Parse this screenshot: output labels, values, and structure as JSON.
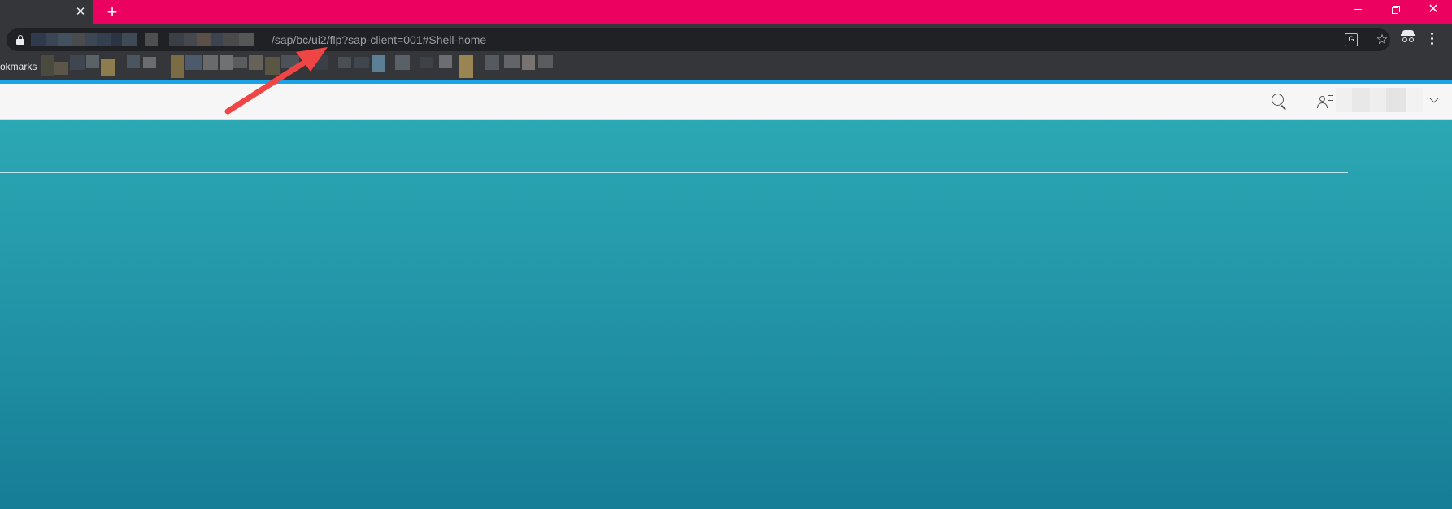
{
  "browser": {
    "tab_close_glyph": "✕",
    "new_tab_glyph": "+",
    "window_controls": {
      "close_glyph": "✕"
    },
    "address_bar": {
      "url_visible": "/sap/bc/ui2/flp?sap-client=001#Shell-home"
    },
    "bookmarks_bar": {
      "label": "okmarks"
    },
    "colors": {
      "tab_strip": "#ec0060",
      "toolbar": "#35363a",
      "omnibox": "#202124",
      "progress_line": "#1aa3e8"
    },
    "icons": [
      "lock-icon",
      "translate-icon",
      "star-icon",
      "incognito-icon",
      "menu-icon"
    ]
  },
  "shell": {
    "icons": [
      "search-icon",
      "user-icon",
      "chevron-down-icon"
    ],
    "colors": {
      "bar": "#f6f6f6",
      "canvas_top": "#2ba8b3",
      "canvas_bottom": "#167d96"
    }
  },
  "annotation": {
    "arrow_color": "#f04545"
  }
}
